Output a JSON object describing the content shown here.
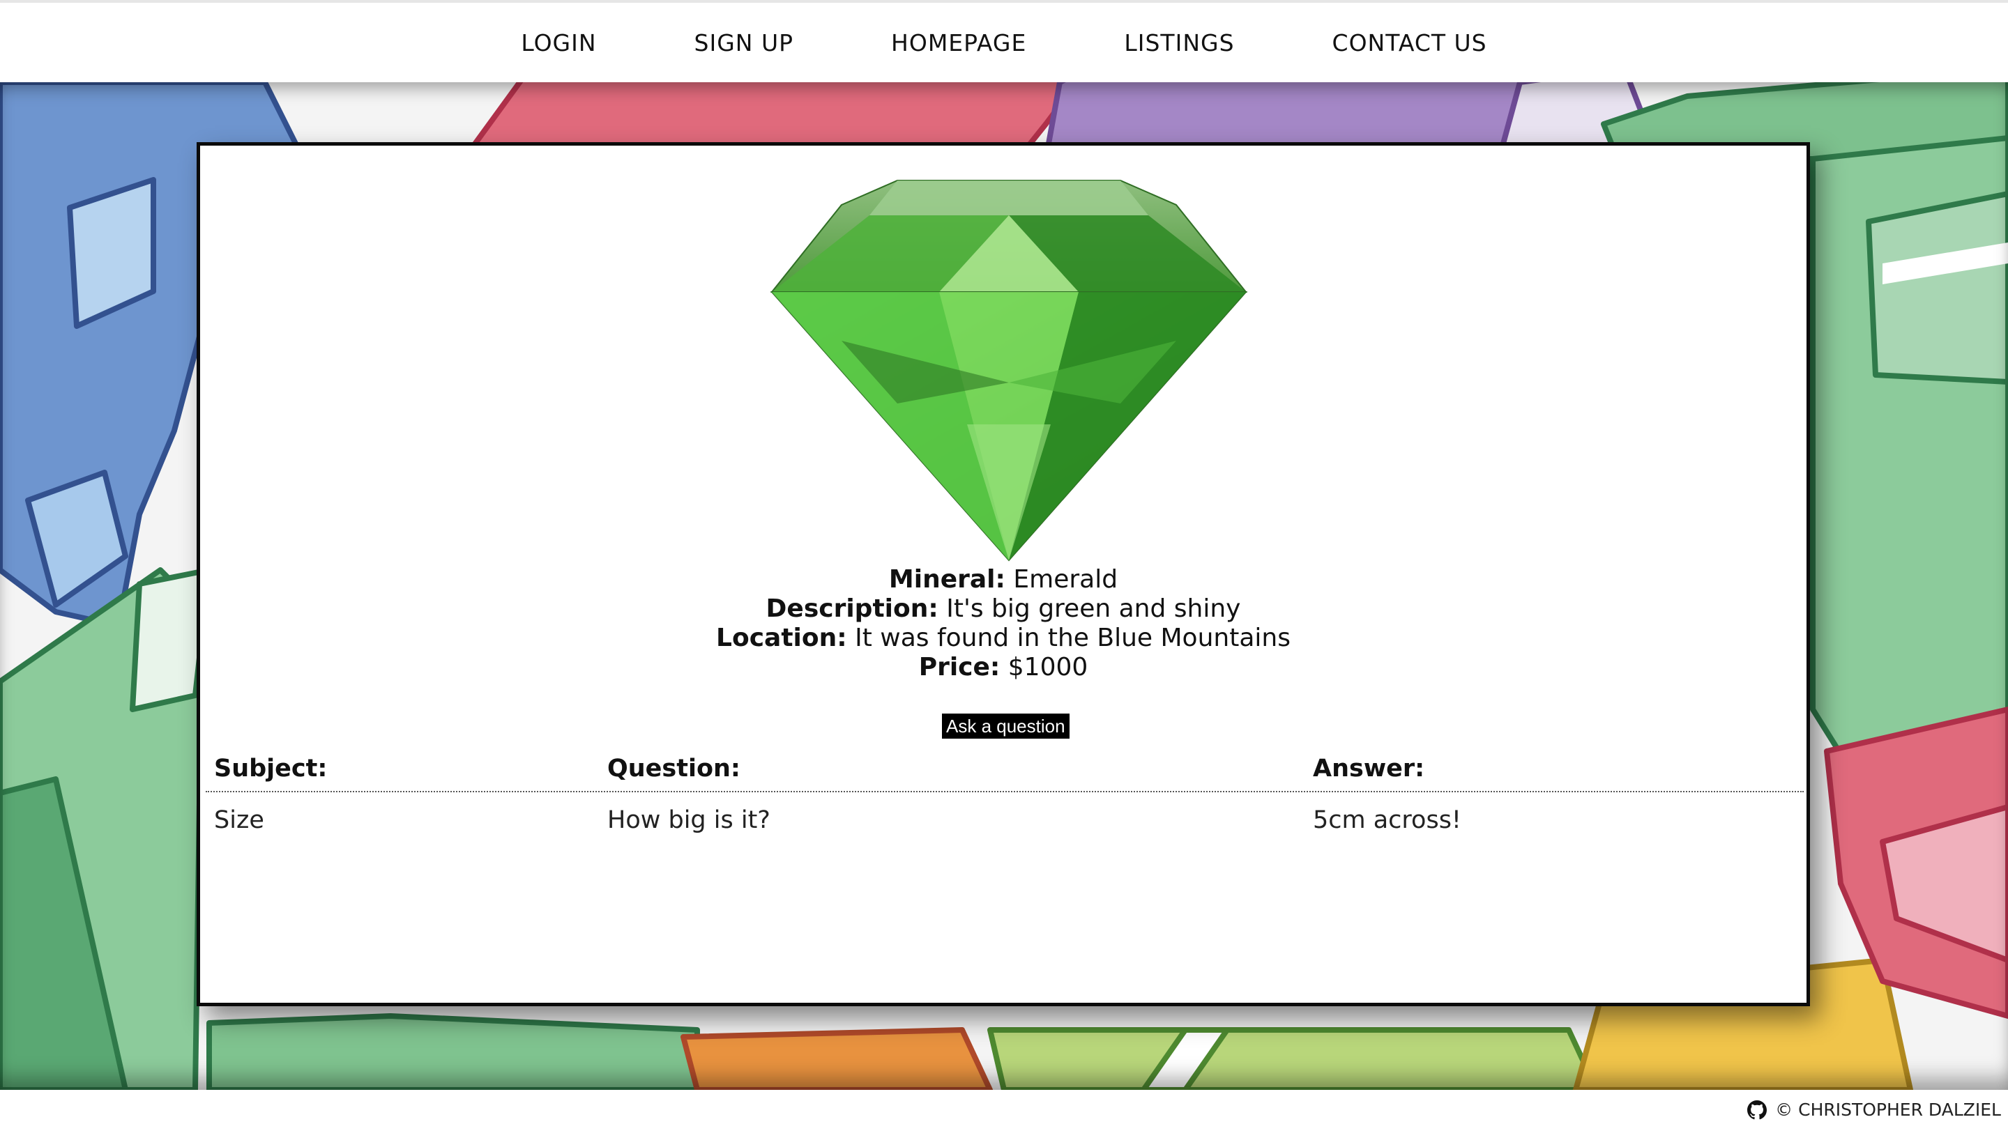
{
  "nav": {
    "items": [
      "LOGIN",
      "SIGN UP",
      "HOMEPAGE",
      "LISTINGS",
      "CONTACT US"
    ]
  },
  "listing": {
    "mineral_label": "Mineral:",
    "mineral": "Emerald",
    "description_label": "Description:",
    "description": "It's big green and shiny",
    "location_label": "Location:",
    "location": "It was found in the Blue Mountains",
    "price_label": "Price:",
    "price": "$1000",
    "gem_icon": "emerald-gem-image",
    "gem_color": "#3fae2a"
  },
  "ask_button": "Ask a question",
  "qa": {
    "headers": [
      "Subject:",
      "Question:",
      "Answer:"
    ],
    "rows": [
      [
        "Size",
        "How big is it?",
        "5cm across!"
      ]
    ]
  },
  "footer": {
    "credit": "© CHRISTOPHER DALZIEL",
    "icon": "github-icon"
  },
  "colors": {
    "blue_crystal": "#6f95cf",
    "red_crystal": "#e05a70",
    "purple_crystal": "#9b7bbd",
    "green_crystal": "#7dc18e",
    "orange_crystal": "#e8923f",
    "yellow_crystal": "#f0c44a"
  }
}
